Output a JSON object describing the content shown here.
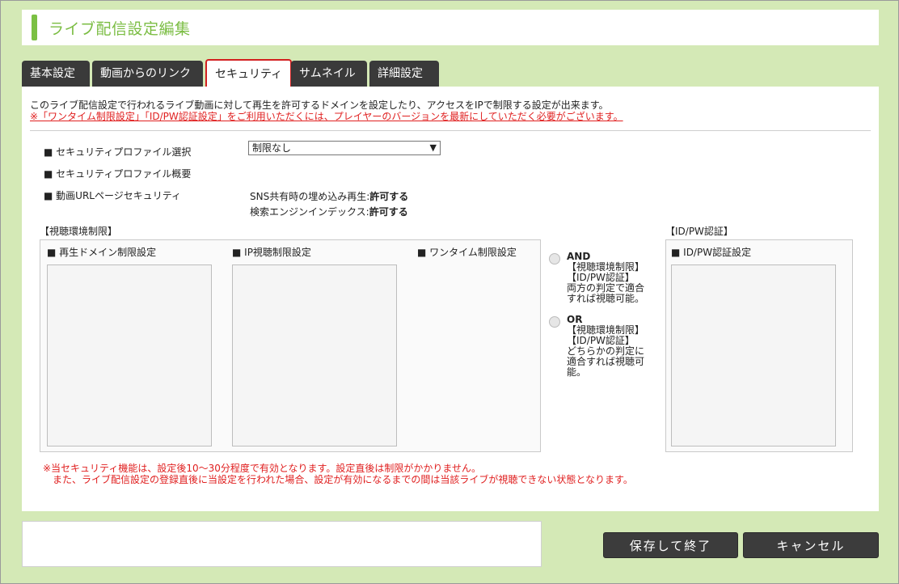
{
  "page_title": "ライブ配信設定編集",
  "tabs": [
    {
      "label": "基本設定"
    },
    {
      "label": "動画からのリンク"
    },
    {
      "label": "セキュリティ",
      "active": true
    },
    {
      "label": "サムネイル"
    },
    {
      "label": "詳細設定"
    }
  ],
  "security": {
    "description": "このライブ配信設定で行われるライブ動画に対して再生を許可するドメインを設定したり、アクセスをIPで制限する設定が出来ます。",
    "warning": "※「ワンタイム制限設定」「ID/PW認証設定」をご利用いただくには、プレイヤーのバージョンを最新にしていただく必要がございます。",
    "profile_select_label": "セキュリティプロファイル選択",
    "profile_select_value": "制限なし",
    "profile_summary_label": "セキュリティプロファイル概要",
    "url_page_label": "動画URLページセキュリティ",
    "sns_text": "SNS共有時の埋め込み再生:",
    "sns_value": "許可する",
    "search_text": "検索エンジンインデックス:",
    "search_value": "許可する",
    "env_section_label": "【視聴環境制限】",
    "domain_label": "再生ドメイン制限設定",
    "ip_label": "IP視聴制限設定",
    "onetime_label": "ワンタイム制限設定",
    "and_title": "AND",
    "and_line1": "【視聴環境制限】",
    "and_line2": "【ID/PW認証】",
    "and_line3": "両方の判定で適合",
    "and_line4": "すれば視聴可能。",
    "or_title": "OR",
    "or_line1": "【視聴環境制限】",
    "or_line2": "【ID/PW認証】",
    "or_line3": "どちらかの判定に",
    "or_line4": "適合すれば視聴可",
    "or_line5": "能。",
    "idpw_section_label": "【ID/PW認証】",
    "idpw_label": "ID/PW認証設定",
    "note_line1": "※当セキュリティ機能は、設定後10～30分程度で有効となります。設定直後は制限がかかりません。",
    "note_line2": "また、ライブ配信設定の登録直後に当設定を行われた場合、設定が有効になるまでの間は当該ライブが視聴できない状態となります。"
  },
  "buttons": {
    "save": "保存して終了",
    "cancel": "キャンセル"
  },
  "colors": {
    "background": "#d4e9b6",
    "accent": "#7bc043",
    "tab_dark": "#3a3a3a",
    "active_tab_border": "#d32020",
    "warning": "#e02020"
  }
}
